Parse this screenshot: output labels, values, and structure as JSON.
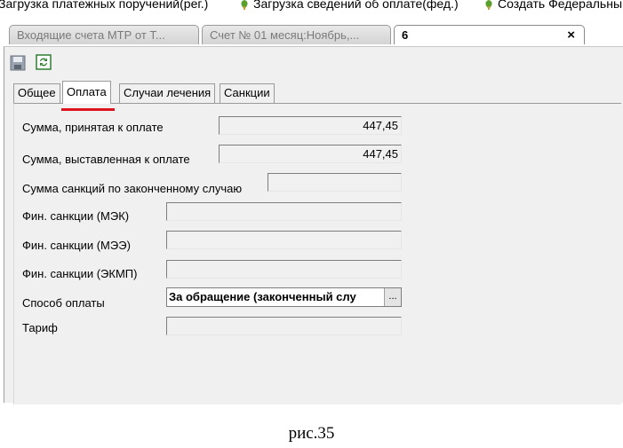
{
  "toolbar": {
    "items": [
      {
        "label": "Загрузка платежных поручений(рег.)"
      },
      {
        "label": "Загрузка сведений об оплате(фед.)",
        "icon": "leaf-icon"
      },
      {
        "label": "Создать Федеральны",
        "icon": "leaf-icon"
      }
    ]
  },
  "doc_tabs": [
    {
      "label": "Входящие счета МТР от Т..."
    },
    {
      "label": "Счет № 01 месяц:Ноябрь,..."
    },
    {
      "label": "6",
      "active": true,
      "close": "×"
    }
  ],
  "inner_tabs": [
    {
      "label": "Общее"
    },
    {
      "label": "Оплата",
      "active": true
    },
    {
      "label": "Случаи лечения"
    },
    {
      "label": "Санкции"
    }
  ],
  "form": {
    "sum_accepted_label": "Сумма, принятая к оплате",
    "sum_accepted_value": "447,45",
    "sum_billed_label": "Сумма, выставленная к оплате",
    "sum_billed_value": "447,45",
    "sanctions_total_label": "Сумма санкций по законченному случаю",
    "sanctions_total_value": "",
    "fin_mek_label": "Фин. санкции (МЭК)",
    "fin_mee_label": "Фин. санкции (МЭЭ)",
    "fin_ekmp_label": "Фин. санкции (ЭКМП)",
    "payment_method_label": "Способ оплаты",
    "payment_method_value": "За обращение (законченный слу",
    "payment_method_button": "...",
    "tariff_label": "Тариф"
  },
  "caption": "рис.35",
  "colors": {
    "accent_underline": "#e0121b"
  }
}
